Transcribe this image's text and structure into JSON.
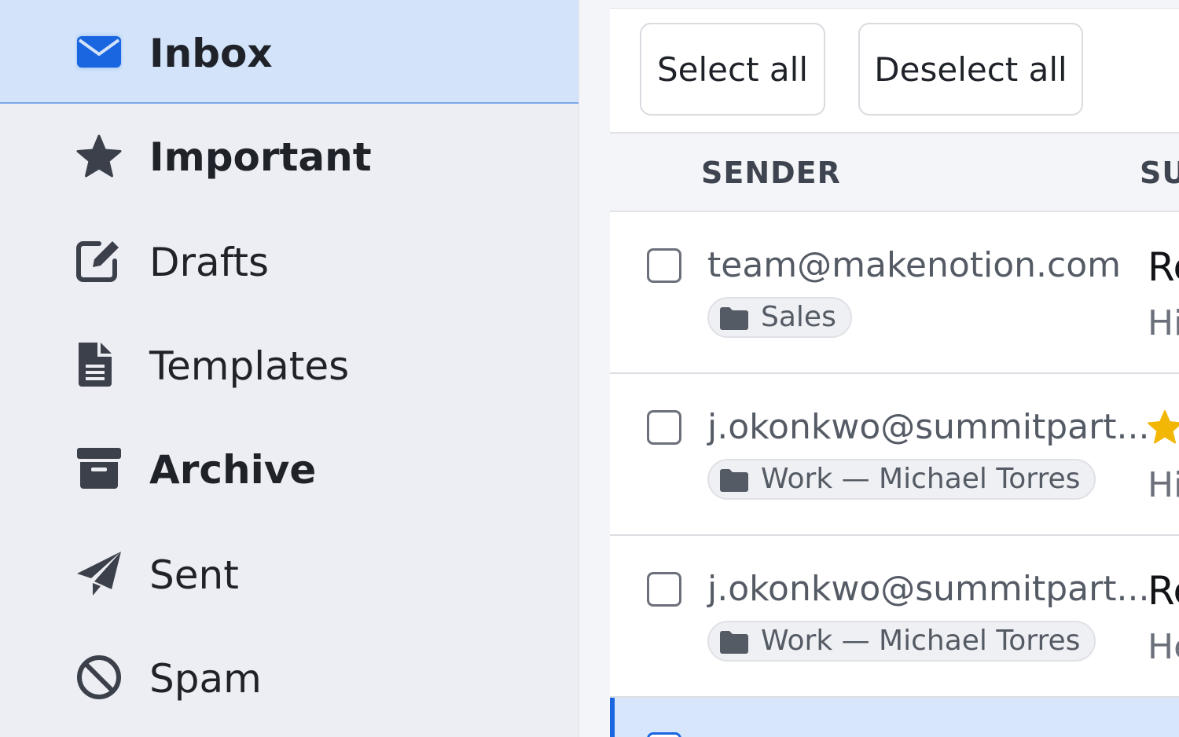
{
  "sidebar": {
    "items": [
      {
        "label": "Inbox",
        "icon": "envelope-icon",
        "active": true
      },
      {
        "label": "Important",
        "icon": "star-icon"
      },
      {
        "label": "Drafts",
        "icon": "edit-icon"
      },
      {
        "label": "Templates",
        "icon": "document-icon"
      },
      {
        "label": "Archive",
        "icon": "archive-icon"
      },
      {
        "label": "Sent",
        "icon": "paper-plane-icon"
      },
      {
        "label": "Spam",
        "icon": "ban-icon"
      }
    ]
  },
  "toolbar": {
    "select_all": "Select all",
    "deselect_all": "Deselect all"
  },
  "columns": {
    "sender": "SENDER",
    "subject": "SU"
  },
  "emails": [
    {
      "sender": "team@makenotion.com",
      "tag": "Sales",
      "subject": "Re",
      "preview": "Hi",
      "starred": false
    },
    {
      "sender": "j.okonkwo@summitpart...",
      "tag": "Work — Michael Torres",
      "subject": "",
      "preview": "Hi",
      "starred": true
    },
    {
      "sender": "j.okonkwo@summitpart...",
      "tag": "Work — Michael Torres",
      "subject": "Re",
      "preview": "He",
      "starred": false
    }
  ],
  "colors": {
    "accent": "#1a66e0",
    "active_bg": "#d2e3fa",
    "star": "#f2b705"
  }
}
